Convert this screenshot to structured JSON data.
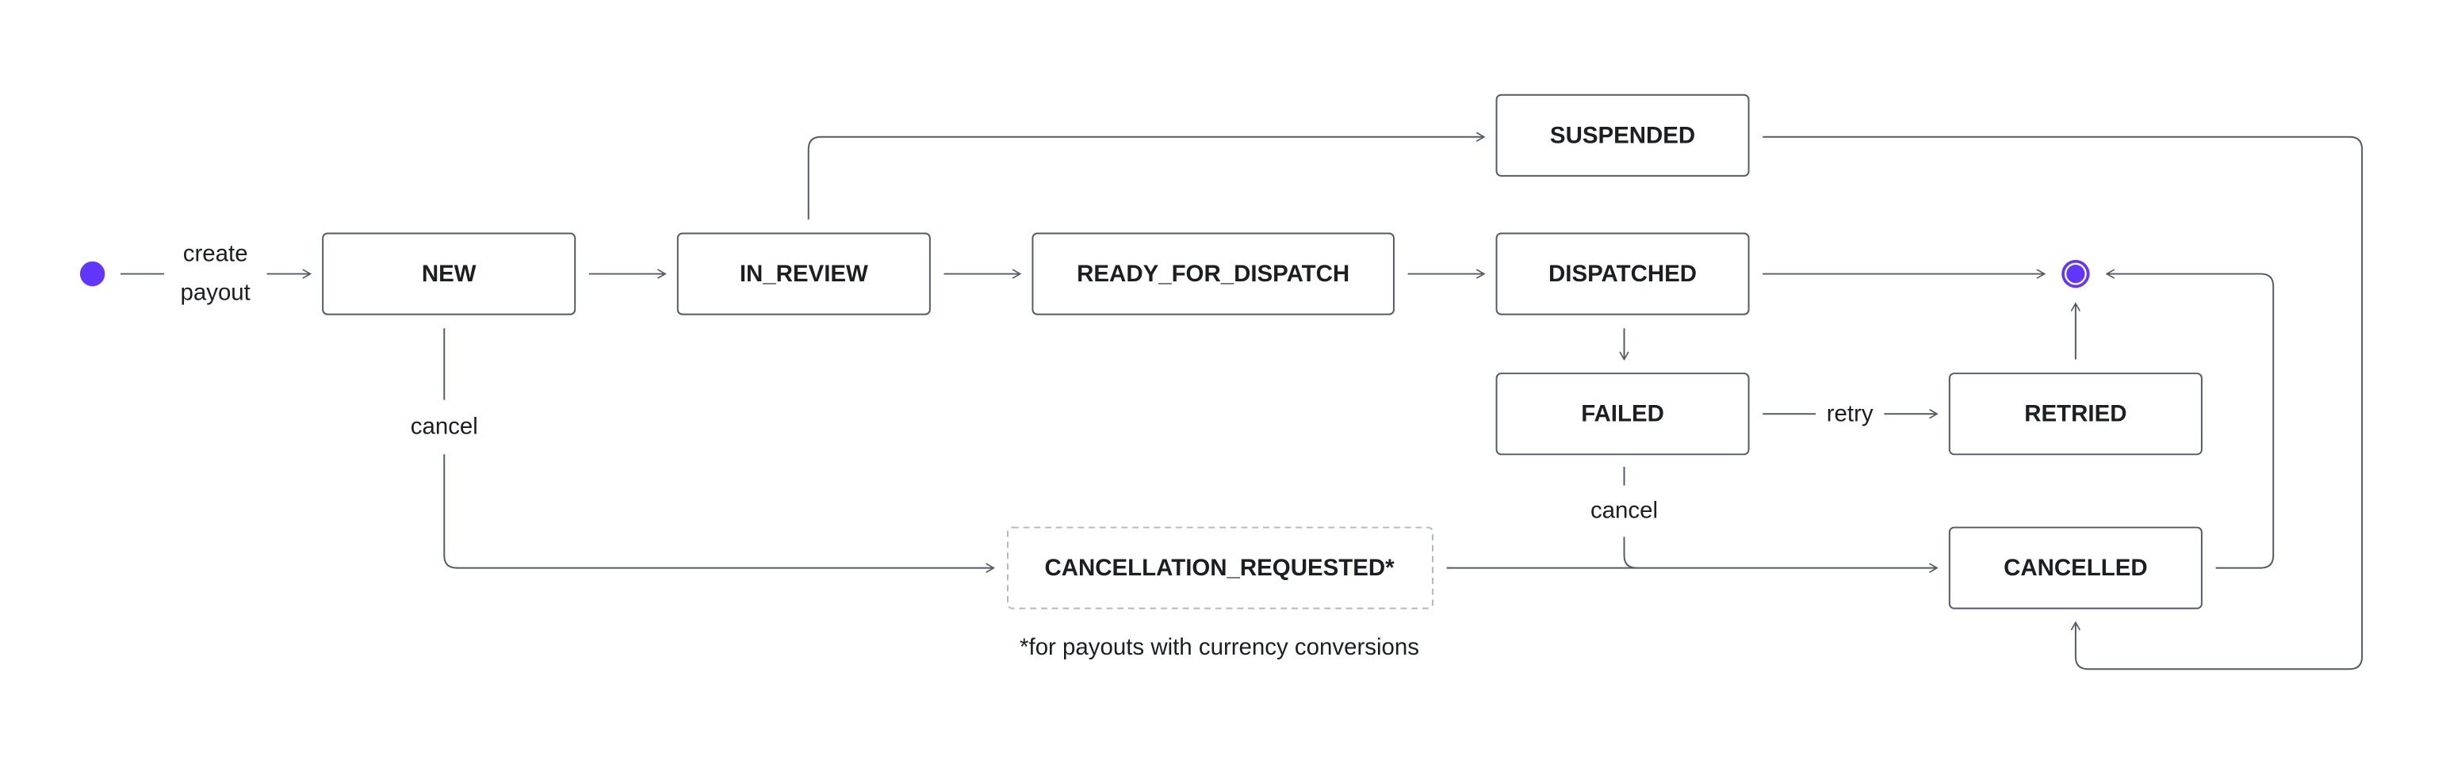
{
  "colors": {
    "accent": "#6236ff",
    "line": "#555a62",
    "text": "#1c1e21",
    "dashed_border": "#b4b7bc"
  },
  "states": {
    "new": "NEW",
    "in_review": "IN_REVIEW",
    "ready_for_dispatch": "READY_FOR_DISPATCH",
    "dispatched": "DISPATCHED",
    "suspended": "SUSPENDED",
    "failed": "FAILED",
    "retried": "RETRIED",
    "cancelled": "CANCELLED",
    "cancellation_requested": "CANCELLATION_REQUESTED*"
  },
  "labels": {
    "create_line1": "create",
    "create_line2": "payout",
    "cancel_new": "cancel",
    "cancel_failed": "cancel",
    "retry": "retry"
  },
  "footnote": "*for payouts with currency conversions"
}
